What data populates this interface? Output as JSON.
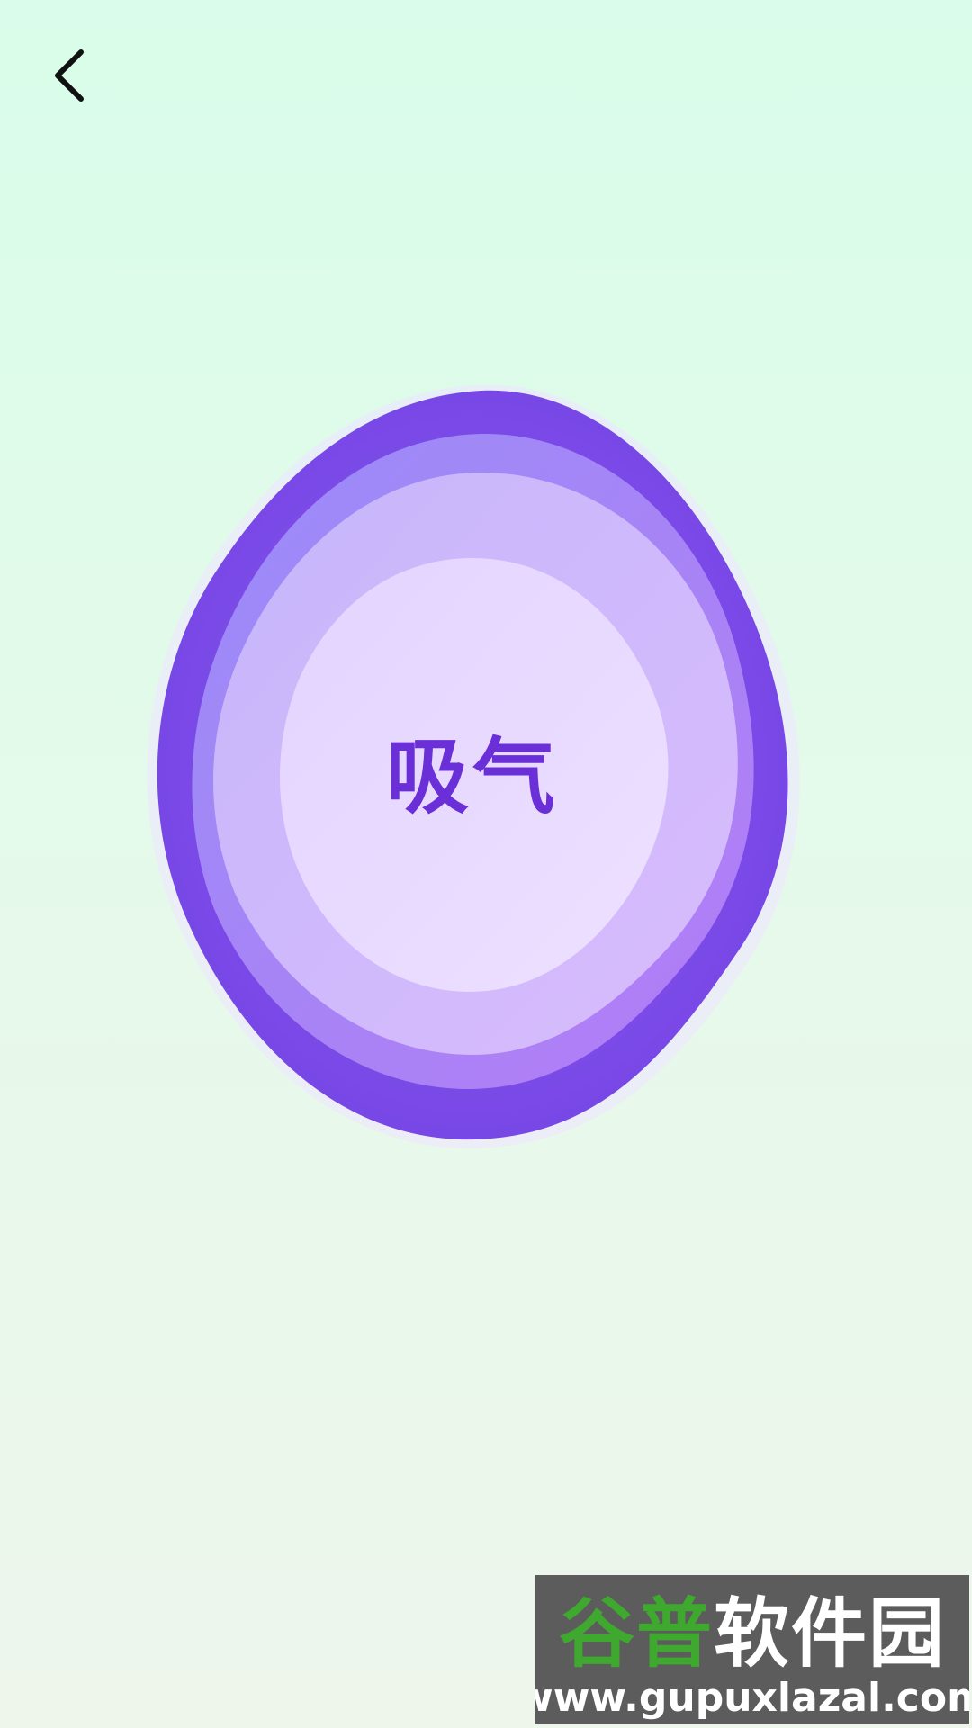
{
  "header": {
    "back_icon": "chevron-left-icon"
  },
  "breathing": {
    "instruction": "吸气",
    "colors": {
      "outer": "#7b4ae6",
      "ring2": "#a683f6",
      "ring3": "#cbb4fb",
      "core": "#e8daff",
      "text": "#6b2fd8"
    }
  },
  "watermark": {
    "title_part1": "谷普",
    "title_part2": "软件园",
    "url": "www.gupuxlazal.com"
  },
  "colors": {
    "background_top": "#d9fdea",
    "background_bottom": "#eef6ec"
  }
}
